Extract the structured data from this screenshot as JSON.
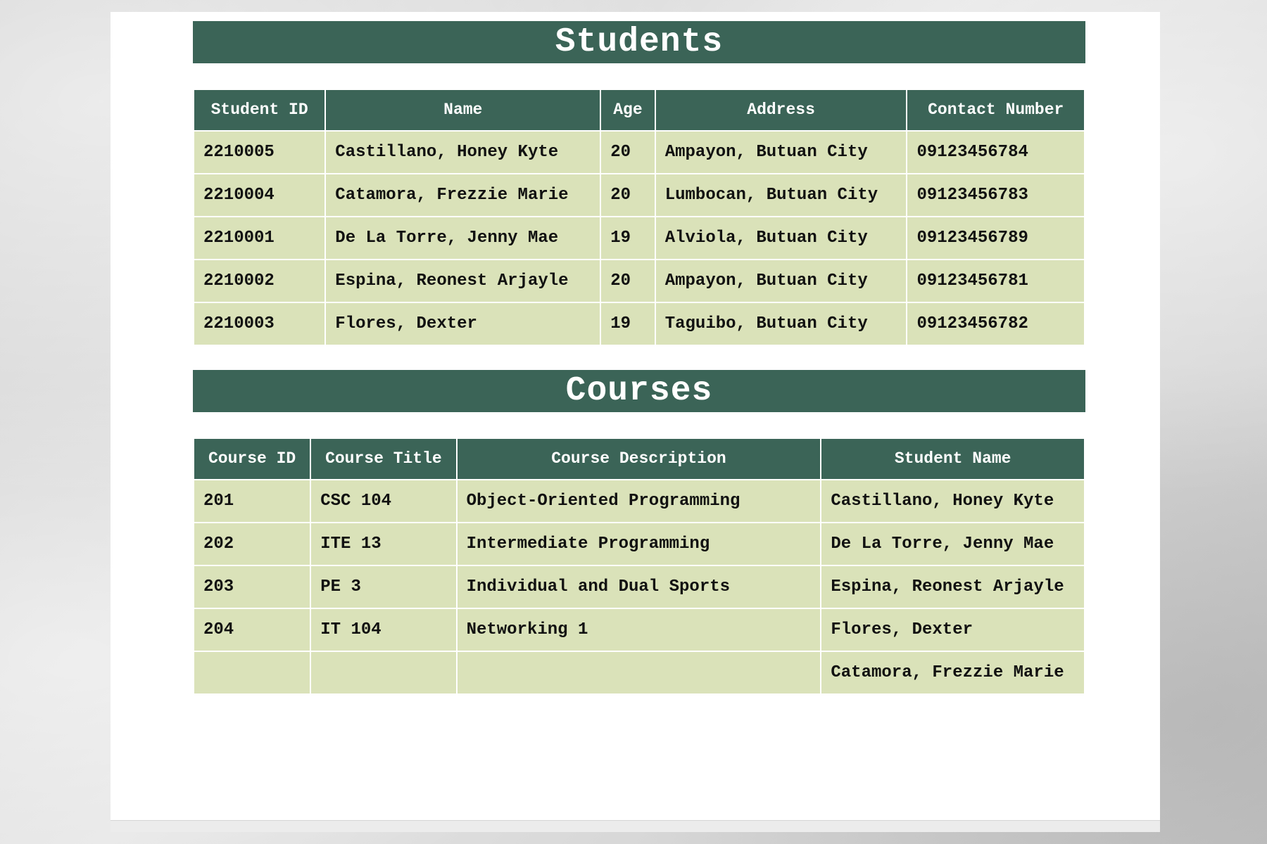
{
  "students": {
    "title": "Students",
    "headers": [
      "Student ID",
      "Name",
      "Age",
      "Address",
      "Contact Number"
    ],
    "rows": [
      [
        "2210005",
        "Castillano, Honey Kyte",
        "20",
        "Ampayon, Butuan City",
        "09123456784"
      ],
      [
        "2210004",
        "Catamora, Frezzie Marie",
        "20",
        "Lumbocan, Butuan City",
        "09123456783"
      ],
      [
        "2210001",
        "De La Torre, Jenny Mae",
        "19",
        "Alviola, Butuan City",
        "09123456789"
      ],
      [
        "2210002",
        "Espina, Reonest Arjayle",
        "20",
        "Ampayon, Butuan City",
        "09123456781"
      ],
      [
        "2210003",
        "Flores, Dexter",
        "19",
        "Taguibo, Butuan City",
        "09123456782"
      ]
    ]
  },
  "courses": {
    "title": "Courses",
    "headers": [
      "Course ID",
      "Course Title",
      "Course Description",
      "Student Name"
    ],
    "rows": [
      [
        "201",
        "CSC 104",
        "Object-Oriented Programming",
        "Castillano, Honey Kyte"
      ],
      [
        "202",
        "ITE 13",
        "Intermediate Programming",
        "De La Torre, Jenny Mae"
      ],
      [
        "203",
        "PE 3",
        "Individual and Dual Sports",
        "Espina, Reonest Arjayle"
      ],
      [
        "204",
        "IT 104",
        "Networking 1",
        "Flores, Dexter"
      ],
      [
        "",
        "",
        "",
        "Catamora, Frezzie Marie"
      ]
    ]
  },
  "colors": {
    "header_bg": "#3b6457",
    "cell_bg": "#dae2b9",
    "header_text": "#ffffff"
  }
}
